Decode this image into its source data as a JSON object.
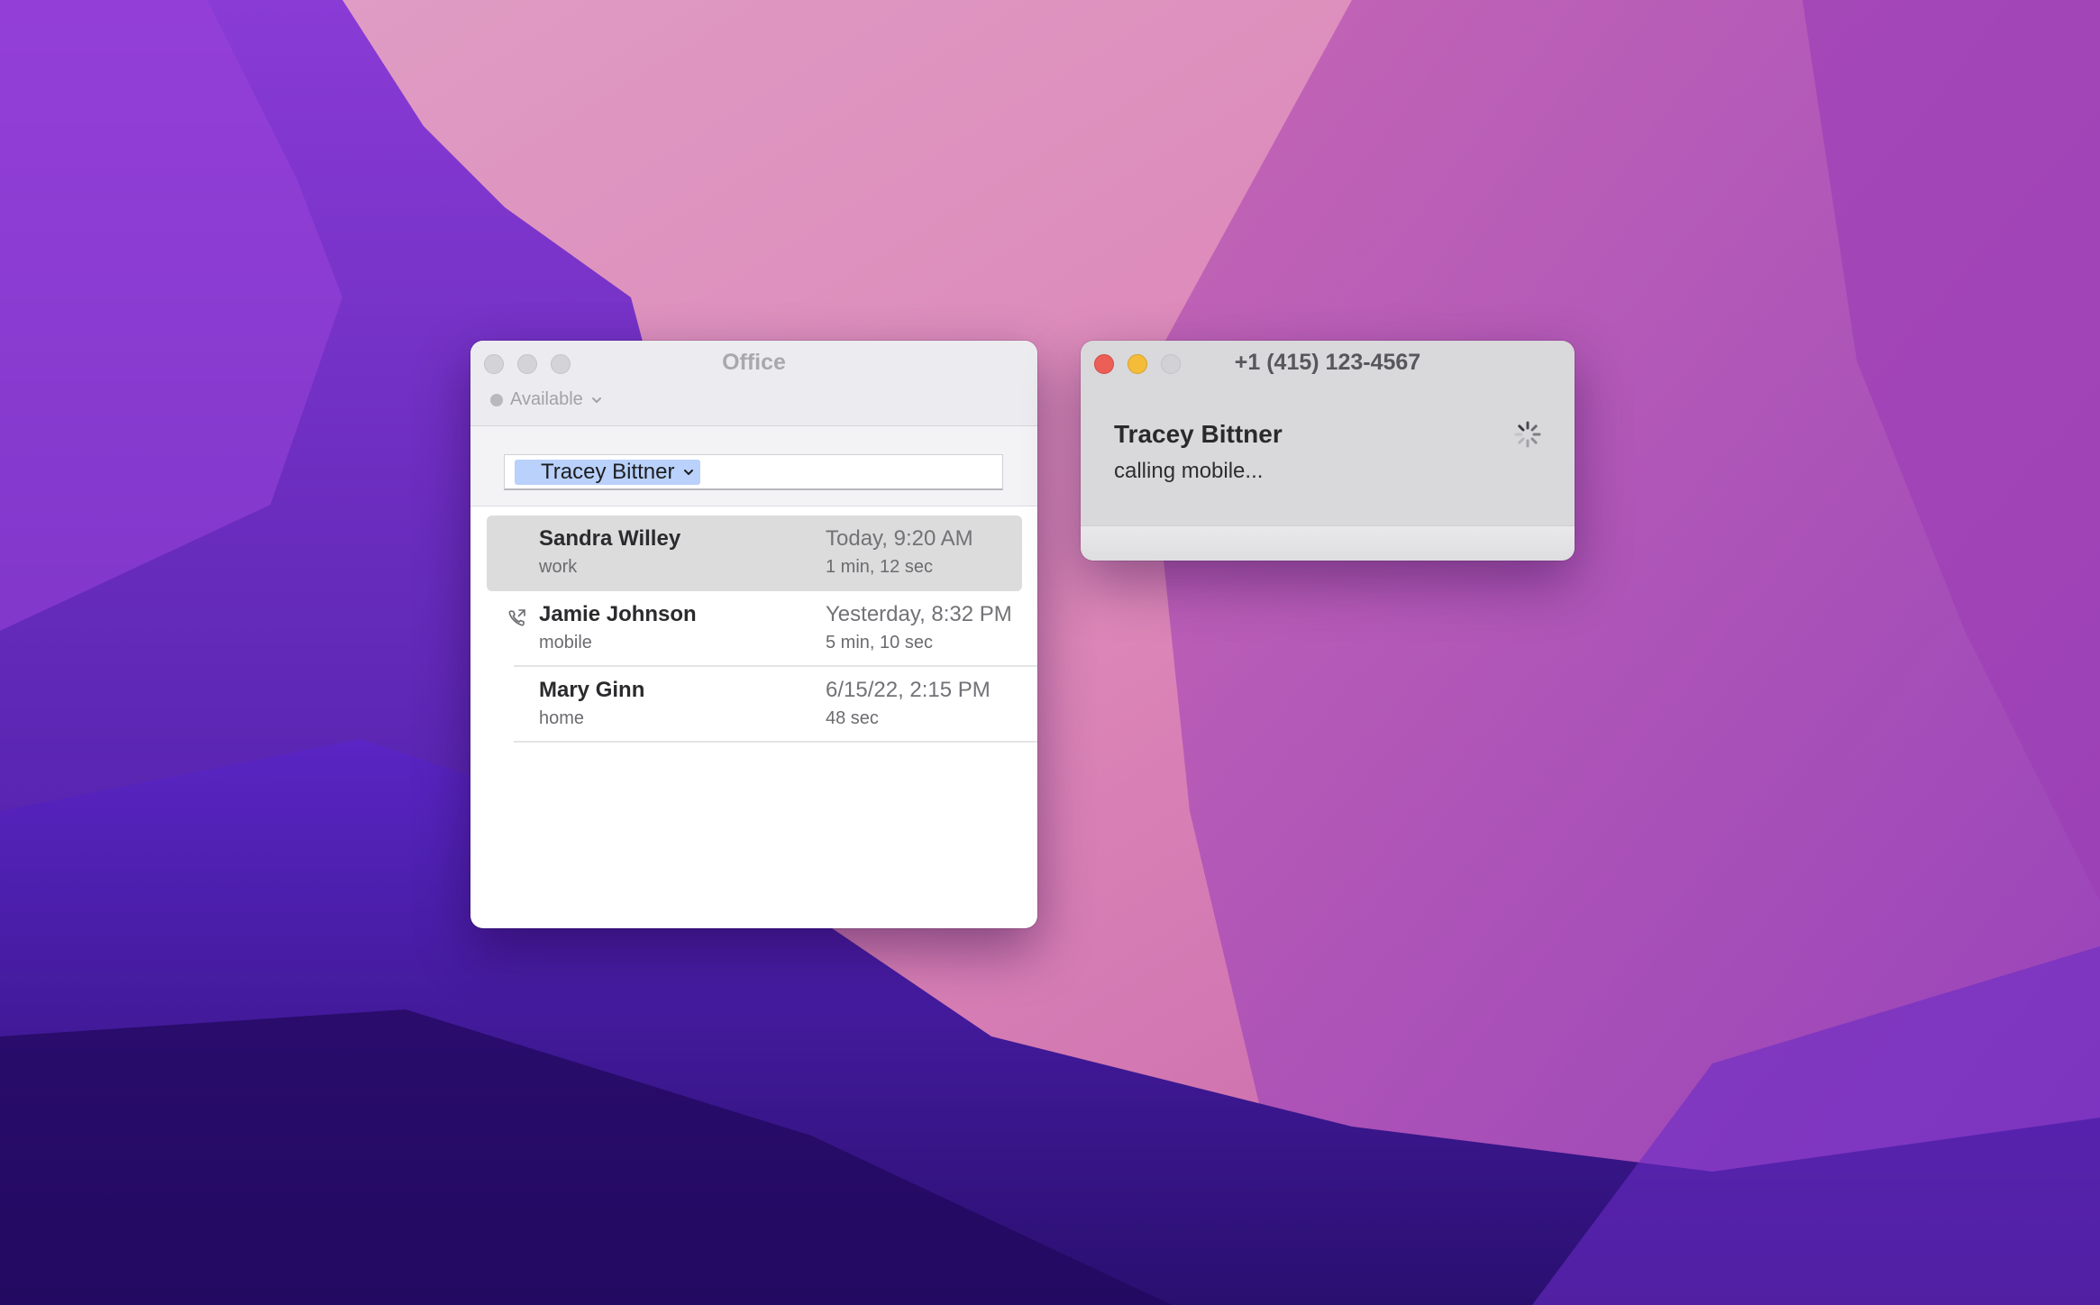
{
  "office_window": {
    "title": "Office",
    "status": {
      "label": "Available",
      "icon": "status-dot-icon",
      "color": "#b9b8bd"
    },
    "recipient_token": {
      "label": "Tracey Bittner"
    },
    "recent_calls": [
      {
        "name": "Sandra Willey",
        "type": "work",
        "time": "Today, 9:20 AM",
        "duration": "1 min, 12 sec",
        "selected": true
      },
      {
        "name": "Jamie Johnson",
        "type": "mobile",
        "time": "Yesterday, 8:32 PM",
        "duration": "5 min, 10 sec",
        "icon": "outgoing-call-icon"
      },
      {
        "name": "Mary Ginn",
        "type": "home",
        "time": "6/15/22, 2:15 PM",
        "duration": "48 sec"
      }
    ]
  },
  "call_window": {
    "title": "+1 (415) 123-4567",
    "callee": "Tracey Bittner",
    "status": "calling mobile...",
    "icon": "spinner-icon"
  },
  "colors": {
    "token_bg": "#b9d1fb",
    "selected_row": "#dcdcdd",
    "close_red": "#ec5f56",
    "minimize_yellow": "#f3bd39"
  }
}
